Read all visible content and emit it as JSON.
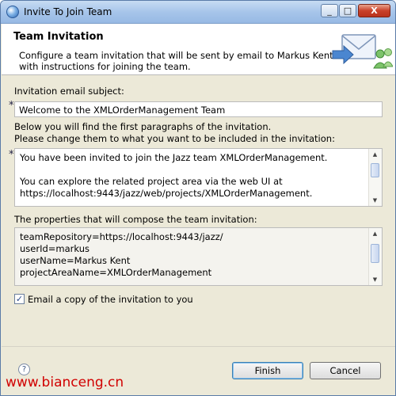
{
  "window": {
    "title": "Invite To Join Team",
    "minimize_glyph": "_",
    "maximize_glyph": "□",
    "close_glyph": "X"
  },
  "header": {
    "title": "Team Invitation",
    "description": "Configure a team invitation that will be sent by email to Markus Kent with instructions for joining the team.",
    "icon": "envelope-with-people-icon"
  },
  "subject": {
    "label": "Invitation email subject:",
    "required_marker": "*",
    "value": "Welcome to the XMLOrderManagement Team"
  },
  "paragraphs": {
    "intro_line1": "Below you will find the first paragraphs of the invitation.",
    "intro_line2": "Please change them to what you want to be included in the invitation:",
    "required_marker": "*",
    "lines": [
      "You have been invited to join the Jazz team XMLOrderManagement.",
      "",
      "You can explore the related project area via the web UI at",
      "https://localhost:9443/jazz/web/projects/XMLOrderManagement."
    ]
  },
  "properties": {
    "label": "The properties that will compose the team invitation:",
    "lines": [
      "teamRepository=https://localhost:9443/jazz/",
      "userId=markus",
      "userName=Markus Kent",
      "projectAreaName=XMLOrderManagement"
    ]
  },
  "email_copy": {
    "checked": true,
    "check_glyph": "✓",
    "label": "Email a copy of the invitation to you"
  },
  "footer": {
    "help_glyph": "?",
    "finish_label": "Finish",
    "cancel_label": "Cancel"
  },
  "watermark": "www.bianceng.cn"
}
